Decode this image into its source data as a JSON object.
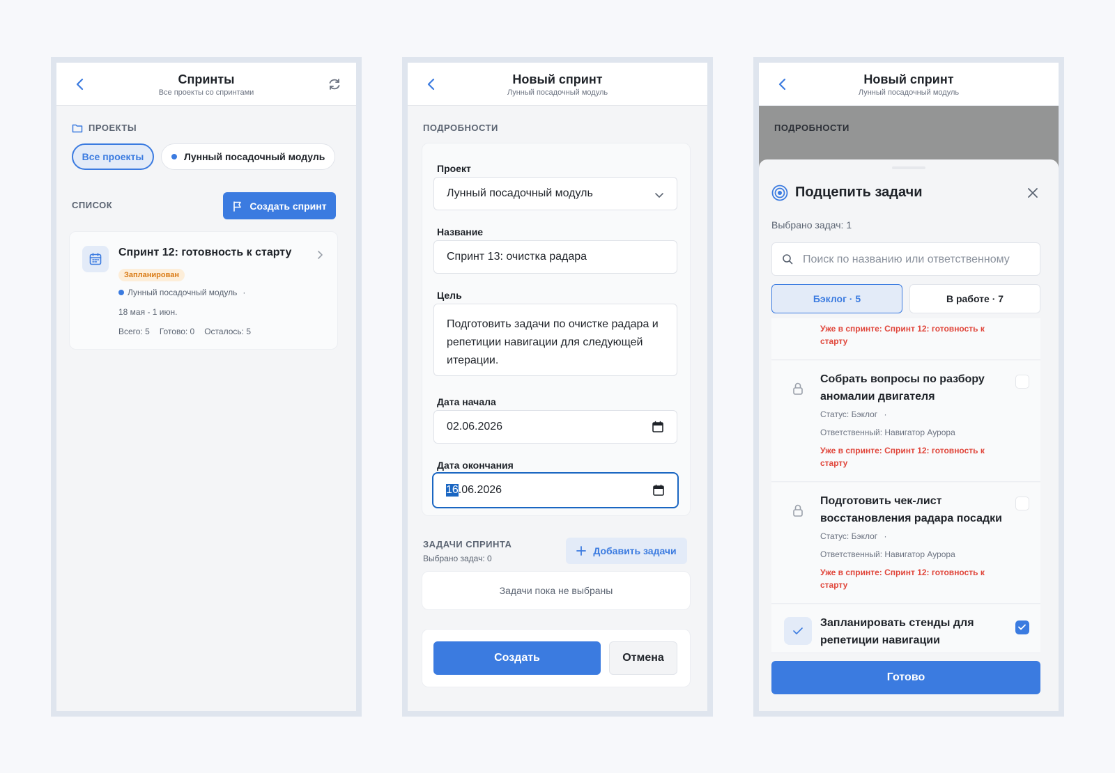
{
  "panel1": {
    "header": {
      "title": "Спринты",
      "subtitle": "Все проекты со спринтами"
    },
    "projects_label": "ПРОЕКТЫ",
    "chips": {
      "all": "Все проекты",
      "project": "Лунный посадочный модуль"
    },
    "list_label": "СПИСОК",
    "create_button": "Создать спринт",
    "sprint": {
      "title": "Спринт 12: готовность к старту",
      "status": "Запланирован",
      "project": "Лунный посадочный модуль",
      "separator": "·",
      "dates": "18 мая - 1 июн.",
      "total": "Всего: 5",
      "done": "Готово: 0",
      "left": "Осталось: 5"
    }
  },
  "panel2": {
    "header": {
      "title": "Новый спринт",
      "subtitle": "Лунный посадочный модуль"
    },
    "details_label": "ПОДРОБНОСТИ",
    "form": {
      "project_label": "Проект",
      "project_value": "Лунный посадочный модуль",
      "name_label": "Название",
      "name_value": "Спринт 13: очистка радара",
      "goal_label": "Цель",
      "goal_value": "Подготовить задачи по очистке радара и репетиции навигации для следующей итерации.",
      "start_label": "Дата начала",
      "start_value": "02.06.2026",
      "end_label": "Дата окончания",
      "end_value_selected": "16",
      "end_value_rest": ".06.2026"
    },
    "tasks_label": "ЗАДАЧИ СПРИНТА",
    "tasks_selected": "Выбрано задач: 0",
    "add_tasks_button": "Добавить задачи",
    "empty_text": "Задачи пока не выбраны",
    "create_button": "Создать",
    "cancel_button": "Отмена"
  },
  "panel3": {
    "header": {
      "title": "Новый спринт",
      "subtitle": "Лунный посадочный модуль"
    },
    "details_label": "ПОДРОБНОСТИ",
    "sheet": {
      "title": "Подцепить задачи",
      "selected": "Выбрано задач: 1",
      "search_placeholder": "Поиск по названию или ответственному",
      "tab_backlog": "Бэклог · 5",
      "tab_in_progress": "В работе · 7",
      "partial_warning": "Уже в спринте: Спринт 12: готовность к старту",
      "tasks": [
        {
          "title": "Собрать вопросы по разбору аномалии двигателя",
          "status": "Статус: Бэклог",
          "separator": "·",
          "assignee": "Ответственный: Навигатор Аурора",
          "warning": "Уже в спринте: Спринт 12: готовность к старту"
        },
        {
          "title": "Подготовить чек-лист восстановления радара посадки",
          "status": "Статус: Бэклог",
          "separator": "·",
          "assignee": "Ответственный: Навигатор Аурора",
          "warning": "Уже в спринте: Спринт 12: готовность к старту"
        },
        {
          "title": "Запланировать стенды для репетиции навигации"
        }
      ],
      "done_button": "Готово"
    }
  },
  "colors": {
    "accent": "#3b7be0",
    "warning": "#e0453a",
    "badge_bg": "#fdeed9",
    "badge_text": "#d97a14"
  }
}
